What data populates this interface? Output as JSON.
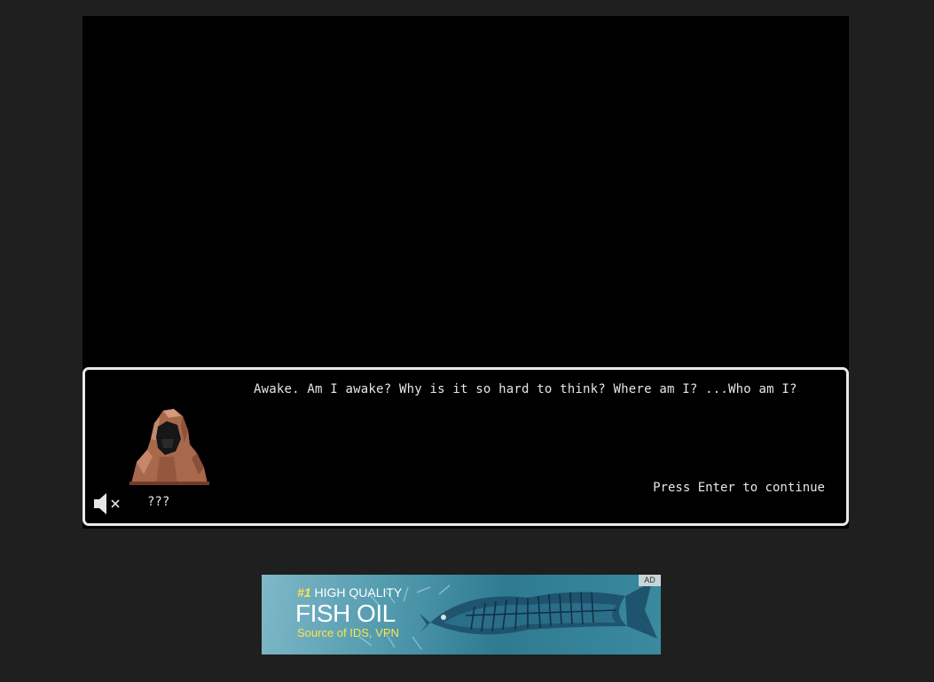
{
  "dialog": {
    "text": "Awake. Am I awake? Why is it so hard to think? Where am I? ...Who am I?",
    "speaker": "???",
    "prompt": "Press Enter to continue"
  },
  "portrait": {
    "icon": "hooded-figure-portrait",
    "hood_color": "#b5775a"
  },
  "audio": {
    "icon": "speaker-muted-icon"
  },
  "ad": {
    "tag": "AD",
    "rank": "#1",
    "headline": "HIGH QUALITY",
    "product": "FISH OIL",
    "subline": "Source of IDS, VPN",
    "accent_color": "#ffe34d"
  }
}
